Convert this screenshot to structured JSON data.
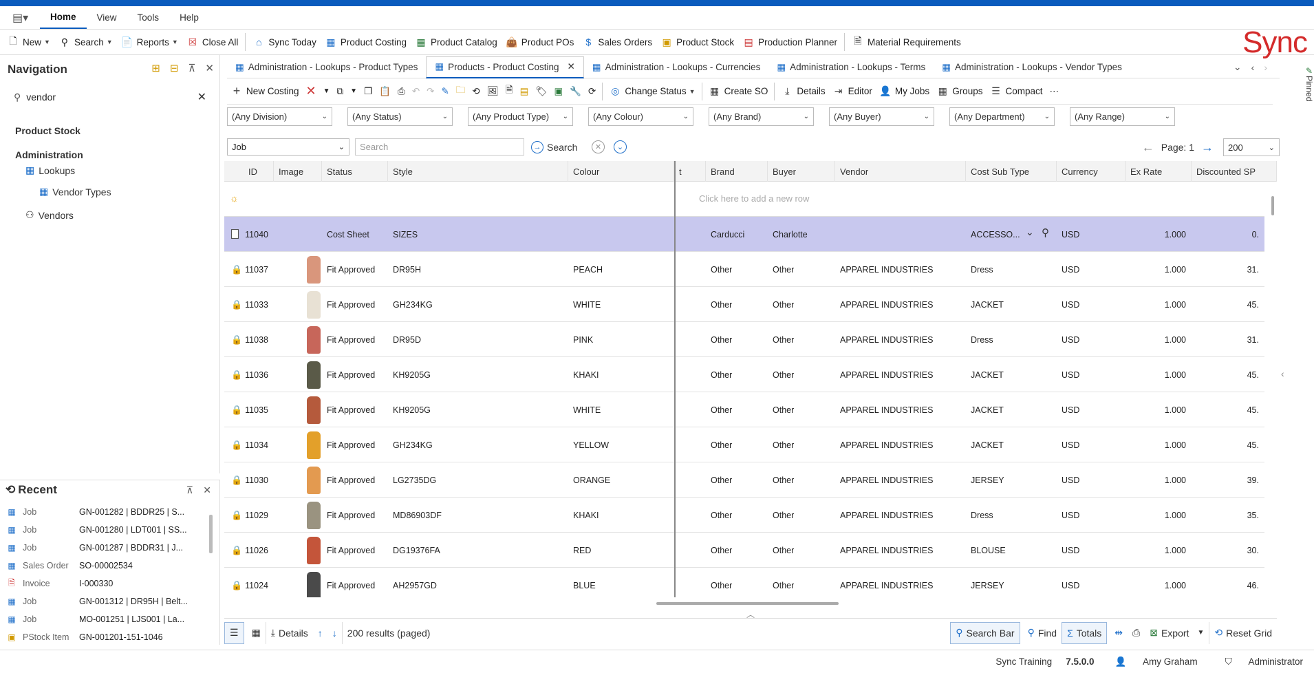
{
  "menu": {
    "tabs": [
      {
        "label": "Home"
      },
      {
        "label": "View"
      },
      {
        "label": "Tools"
      },
      {
        "label": "Help"
      }
    ]
  },
  "toolbar": {
    "new": "New",
    "search": "Search",
    "reports": "Reports",
    "close_all": "Close All",
    "sync_today": "Sync Today",
    "product_costing": "Product Costing",
    "product_catalog": "Product Catalog",
    "product_pos": "Product POs",
    "sales_orders": "Sales Orders",
    "product_stock": "Product Stock",
    "production_planner": "Production Planner",
    "material_requirements": "Material Requirements"
  },
  "logo": "Sync",
  "navigation": {
    "title": "Navigation",
    "search_value": "vendor",
    "items": [
      {
        "label": "Product Stock"
      },
      {
        "label": "Administration"
      },
      {
        "label": "Lookups"
      },
      {
        "label": "Vendor Types"
      },
      {
        "label": "Vendors"
      }
    ]
  },
  "recent": {
    "title": "Recent",
    "items": [
      {
        "type": "Job",
        "value": "GN-001282 |  BDDR25 | S..."
      },
      {
        "type": "Job",
        "value": "GN-001280 |  LDT001 | SS..."
      },
      {
        "type": "Job",
        "value": "GN-001287 |  BDDR31 | J..."
      },
      {
        "type": "Sales Order",
        "value": "SO-00002534"
      },
      {
        "type": "Invoice",
        "value": "I-000330"
      },
      {
        "type": "Job",
        "value": "GN-001312 |  DR95H | Belt..."
      },
      {
        "type": "Job",
        "value": "MO-001251 |  LJS001 | La..."
      },
      {
        "type": "PStock Item",
        "value": "GN-001201-151-1046"
      }
    ]
  },
  "doc_tabs": [
    {
      "label": "Administration - Lookups - Product Types"
    },
    {
      "label": "Products - Product Costing"
    },
    {
      "label": "Administration - Lookups - Currencies"
    },
    {
      "label": "Administration - Lookups - Terms"
    },
    {
      "label": "Administration - Lookups - Vendor Types"
    }
  ],
  "pinned": "Pinned",
  "grid_toolbar": {
    "new_costing": "New Costing",
    "change_status": "Change Status",
    "create_so": "Create SO",
    "details": "Details",
    "editor": "Editor",
    "my_jobs": "My Jobs",
    "groups": "Groups",
    "compact": "Compact"
  },
  "filters": [
    {
      "value": "(Any Division)"
    },
    {
      "value": "(Any Status)"
    },
    {
      "value": "(Any Product Type)"
    },
    {
      "value": "(Any Colour)"
    },
    {
      "value": "(Any Brand)"
    },
    {
      "value": "(Any Buyer)"
    },
    {
      "value": "(Any Department)"
    },
    {
      "value": "(Any Range)"
    }
  ],
  "search": {
    "scope": "Job",
    "placeholder": "Search",
    "button": "Search",
    "page_label": "Page: 1",
    "page_size": "200"
  },
  "grid": {
    "columns": [
      {
        "label": "ID"
      },
      {
        "label": "Image"
      },
      {
        "label": "Status"
      },
      {
        "label": "Style"
      },
      {
        "label": "Colour"
      },
      {
        "label": "t"
      },
      {
        "label": "Brand"
      },
      {
        "label": "Buyer"
      },
      {
        "label": "Vendor"
      },
      {
        "label": "Cost Sub Type"
      },
      {
        "label": "Currency"
      },
      {
        "label": "Ex Rate"
      },
      {
        "label": "Discounted SP"
      }
    ],
    "add_row_text": "Click here to add a new row",
    "rows": [
      {
        "id": "11040",
        "status": "Cost Sheet",
        "style": "SIZES",
        "colour": "",
        "brand": "Carducci",
        "buyer": "Charlotte",
        "vendor": "",
        "cost_sub_type": "ACCESSO...",
        "currency": "USD",
        "ex_rate": "1.000",
        "discounted_sp": "0.",
        "thumb_color": ""
      },
      {
        "id": "11037",
        "status": "Fit Approved",
        "style": "DR95H",
        "colour": "PEACH",
        "brand": "Other",
        "buyer": "Other",
        "vendor": "APPAREL INDUSTRIES",
        "cost_sub_type": "Dress",
        "currency": "USD",
        "ex_rate": "1.000",
        "discounted_sp": "31.",
        "thumb_color": "#d9967c"
      },
      {
        "id": "11033",
        "status": "Fit Approved",
        "style": "GH234KG",
        "colour": "WHITE",
        "brand": "Other",
        "buyer": "Other",
        "vendor": "APPAREL INDUSTRIES",
        "cost_sub_type": "JACKET",
        "currency": "USD",
        "ex_rate": "1.000",
        "discounted_sp": "45.",
        "thumb_color": "#e8e1d4"
      },
      {
        "id": "11038",
        "status": "Fit Approved",
        "style": "DR95D",
        "colour": "PINK",
        "brand": "Other",
        "buyer": "Other",
        "vendor": "APPAREL INDUSTRIES",
        "cost_sub_type": "Dress",
        "currency": "USD",
        "ex_rate": "1.000",
        "discounted_sp": "31.",
        "thumb_color": "#c7665a"
      },
      {
        "id": "11036",
        "status": "Fit Approved",
        "style": "KH9205G",
        "colour": "KHAKI",
        "brand": "Other",
        "buyer": "Other",
        "vendor": "APPAREL INDUSTRIES",
        "cost_sub_type": "JACKET",
        "currency": "USD",
        "ex_rate": "1.000",
        "discounted_sp": "45.",
        "thumb_color": "#5a5a48"
      },
      {
        "id": "11035",
        "status": "Fit Approved",
        "style": "KH9205G",
        "colour": "WHITE",
        "brand": "Other",
        "buyer": "Other",
        "vendor": "APPAREL INDUSTRIES",
        "cost_sub_type": "JACKET",
        "currency": "USD",
        "ex_rate": "1.000",
        "discounted_sp": "45.",
        "thumb_color": "#b55a3c"
      },
      {
        "id": "11034",
        "status": "Fit Approved",
        "style": "GH234KG",
        "colour": "YELLOW",
        "brand": "Other",
        "buyer": "Other",
        "vendor": "APPAREL INDUSTRIES",
        "cost_sub_type": "JACKET",
        "currency": "USD",
        "ex_rate": "1.000",
        "discounted_sp": "45.",
        "thumb_color": "#e3a02a"
      },
      {
        "id": "11030",
        "status": "Fit Approved",
        "style": "LG2735DG",
        "colour": "ORANGE",
        "brand": "Other",
        "buyer": "Other",
        "vendor": "APPAREL INDUSTRIES",
        "cost_sub_type": "JERSEY",
        "currency": "USD",
        "ex_rate": "1.000",
        "discounted_sp": "39.",
        "thumb_color": "#e39a50"
      },
      {
        "id": "11029",
        "status": "Fit Approved",
        "style": "MD86903DF",
        "colour": "KHAKI",
        "brand": "Other",
        "buyer": "Other",
        "vendor": "APPAREL INDUSTRIES",
        "cost_sub_type": "Dress",
        "currency": "USD",
        "ex_rate": "1.000",
        "discounted_sp": "35.",
        "thumb_color": "#9a9380"
      },
      {
        "id": "11026",
        "status": "Fit Approved",
        "style": "DG19376FA",
        "colour": "RED",
        "brand": "Other",
        "buyer": "Other",
        "vendor": "APPAREL INDUSTRIES",
        "cost_sub_type": "BLOUSE",
        "currency": "USD",
        "ex_rate": "1.000",
        "discounted_sp": "30.",
        "thumb_color": "#c4553a"
      },
      {
        "id": "11024",
        "status": "Fit Approved",
        "style": "AH2957GD",
        "colour": "BLUE",
        "brand": "Other",
        "buyer": "Other",
        "vendor": "APPAREL INDUSTRIES",
        "cost_sub_type": "JERSEY",
        "currency": "USD",
        "ex_rate": "1.000",
        "discounted_sp": "46.",
        "thumb_color": "#4a4a4a"
      }
    ]
  },
  "bottom": {
    "details": "Details",
    "results": "200 results (paged)",
    "search_bar": "Search Bar",
    "find": "Find",
    "totals": "Totals",
    "export": "Export",
    "reset_grid": "Reset Grid"
  },
  "status": {
    "environment": "Sync Training",
    "version": "7.5.0.0",
    "user": "Amy Graham",
    "role": "Administrator"
  },
  "colors": {
    "accent": "#0a5bbd",
    "logo": "#d42b2b",
    "selected_row": "#c8c8ee"
  }
}
